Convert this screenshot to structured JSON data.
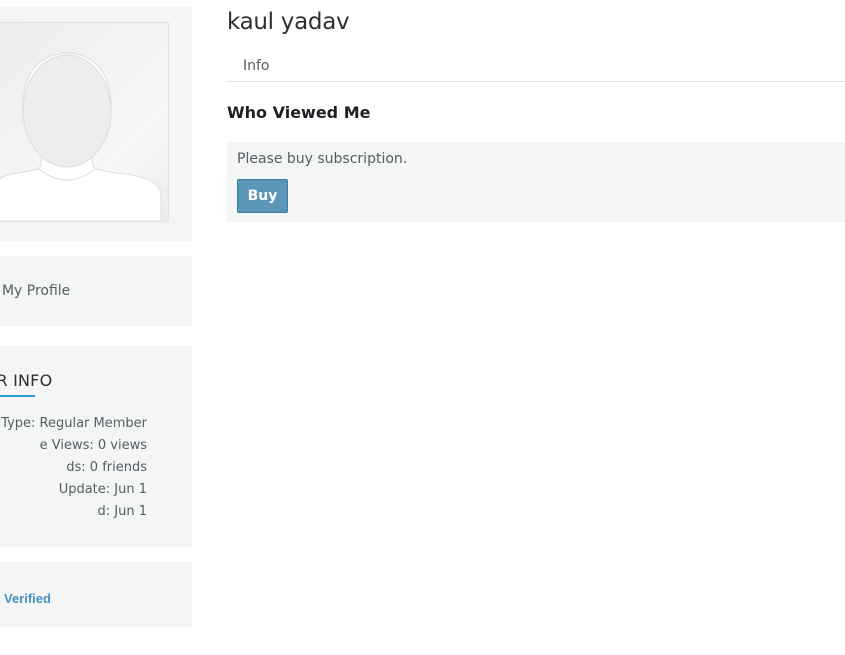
{
  "profile": {
    "name": "kaul yadav",
    "tabs": [
      {
        "label": "Info"
      }
    ],
    "section_title": "Who Viewed Me",
    "notice": "Please buy subscription.",
    "buy_label": "Buy"
  },
  "sidebar": {
    "edit_profile_label": "t My Profile",
    "info_heading": "BER INFO",
    "info_rows": [
      "e Type: Regular Member",
      "e Views: 0 views",
      "ds: 0 friends",
      "Update: Jun 1",
      "d: Jun 1"
    ],
    "verified_label": "Verified"
  },
  "colors": {
    "accent": "#2aa2cf",
    "button": "#5b95b8",
    "verified": "#4a90c2",
    "panel_bg": "#f4f5f5"
  },
  "icons": {
    "avatar": "avatar-silhouette-icon"
  }
}
